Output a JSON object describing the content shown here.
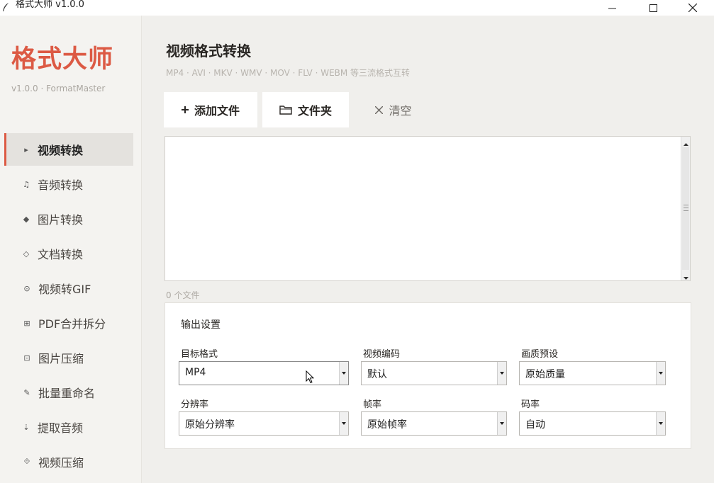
{
  "window": {
    "title": "格式大师 v1.0.0",
    "icons": {
      "app": "quill-icon",
      "minimize": "minimize-icon",
      "maximize": "maximize-icon",
      "close": "close-icon"
    }
  },
  "sidebar": {
    "brand_title": "格式大师",
    "brand_subtitle": "v1.0.0 · FormatMaster",
    "accent_color": "#dc5a44",
    "items": [
      {
        "icon": "▸",
        "icon_name": "triangle-right-icon",
        "label": "视频转换",
        "active": true
      },
      {
        "icon": "♫",
        "icon_name": "music-note-icon",
        "label": "音频转换",
        "active": false
      },
      {
        "icon": "◆",
        "icon_name": "diamond-icon",
        "label": "图片转换",
        "active": false
      },
      {
        "icon": "◇",
        "icon_name": "diamond-outline-icon",
        "label": "文档转换",
        "active": false
      },
      {
        "icon": "⊙",
        "icon_name": "circle-dot-icon",
        "label": "视频转GIF",
        "active": false
      },
      {
        "icon": "⊞",
        "icon_name": "squared-plus-icon",
        "label": "PDF合并拆分",
        "active": false
      },
      {
        "icon": "⊡",
        "icon_name": "squared-dot-icon",
        "label": "图片压缩",
        "active": false
      },
      {
        "icon": "✎",
        "icon_name": "pencil-icon",
        "label": "批量重命名",
        "active": false
      },
      {
        "icon": "⇣",
        "icon_name": "arrow-down-icon",
        "label": "提取音频",
        "active": false
      },
      {
        "icon": "⟐",
        "icon_name": "diamond-dot-icon",
        "label": "视频压缩",
        "active": false
      }
    ]
  },
  "main": {
    "title": "视频格式转换",
    "subtitle": "MP4 · AVI · MKV · WMV · MOV · FLV · WEBM 等三流格式互转",
    "toolbar": {
      "add_icon": "plus-icon",
      "add_label": "添加文件",
      "folder_icon": "folder-icon",
      "folder_label": "文件夹",
      "clear_icon": "close-icon",
      "clear_label": "清空"
    },
    "file_count": "0 个文件",
    "settings": {
      "title": "输出设置",
      "fields": {
        "format": {
          "label": "目标格式",
          "value": "MP4"
        },
        "codec": {
          "label": "视频编码",
          "value": "默认"
        },
        "quality": {
          "label": "画质预设",
          "value": "原始质量"
        },
        "resolution": {
          "label": "分辨率",
          "value": "原始分辨率"
        },
        "framerate": {
          "label": "帧率",
          "value": "原始帧率"
        },
        "bitrate": {
          "label": "码率",
          "value": "自动"
        }
      }
    }
  }
}
